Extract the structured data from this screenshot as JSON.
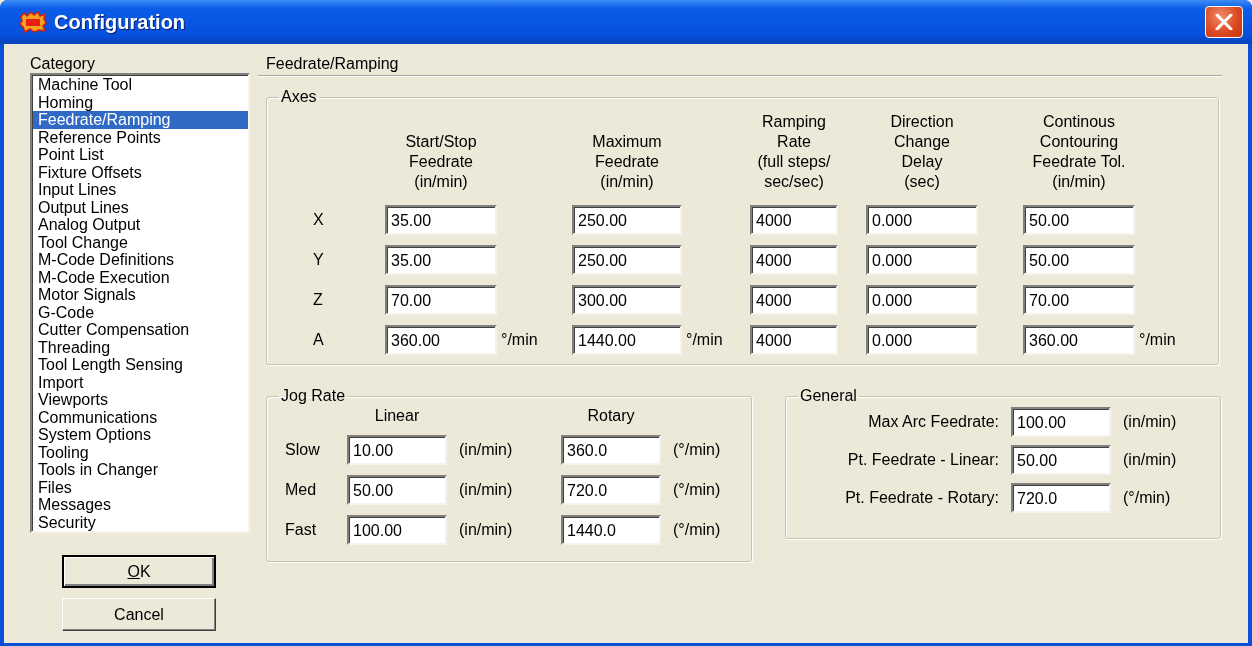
{
  "window": {
    "title": "Configuration"
  },
  "category": {
    "label": "Category",
    "items": [
      {
        "label": "Machine Tool",
        "selected": false
      },
      {
        "label": "Homing",
        "selected": false
      },
      {
        "label": "Feedrate/Ramping",
        "selected": true
      },
      {
        "label": "Reference Points",
        "selected": false
      },
      {
        "label": "Point List",
        "selected": false
      },
      {
        "label": "Fixture Offsets",
        "selected": false
      },
      {
        "label": "Input Lines",
        "selected": false
      },
      {
        "label": "Output Lines",
        "selected": false
      },
      {
        "label": "Analog Output",
        "selected": false
      },
      {
        "label": "Tool Change",
        "selected": false
      },
      {
        "label": "M-Code Definitions",
        "selected": false
      },
      {
        "label": "M-Code Execution",
        "selected": false
      },
      {
        "label": "Motor Signals",
        "selected": false
      },
      {
        "label": "G-Code",
        "selected": false
      },
      {
        "label": "Cutter Compensation",
        "selected": false
      },
      {
        "label": "Threading",
        "selected": false
      },
      {
        "label": "Tool Length Sensing",
        "selected": false
      },
      {
        "label": "Import",
        "selected": false
      },
      {
        "label": "Viewports",
        "selected": false
      },
      {
        "label": "Communications",
        "selected": false
      },
      {
        "label": "System Options",
        "selected": false
      },
      {
        "label": "Tooling",
        "selected": false
      },
      {
        "label": "Tools in Changer",
        "selected": false
      },
      {
        "label": "Files",
        "selected": false
      },
      {
        "label": "Messages",
        "selected": false
      },
      {
        "label": "Security",
        "selected": false
      }
    ]
  },
  "buttons": [
    {
      "label": "OK",
      "default": true
    },
    {
      "label": "Cancel",
      "default": false
    }
  ],
  "panel": {
    "title": "Feedrate/Ramping"
  },
  "axes": {
    "title": "Axes",
    "columns": [
      "Start/Stop\nFeedrate\n(in/min)",
      "Maximum\nFeedrate\n(in/min)",
      "Ramping\nRate\n(full steps/\nsec/sec)",
      "Direction\nChange\nDelay\n(sec)",
      "Continous\nContouring\nFeedrate Tol.\n(in/min)"
    ],
    "rows": [
      {
        "axis": "X",
        "cells": [
          {
            "value": "35.00"
          },
          {
            "value": "250.00"
          },
          {
            "value": "4000"
          },
          {
            "value": "0.000"
          },
          {
            "value": "50.00"
          }
        ]
      },
      {
        "axis": "Y",
        "cells": [
          {
            "value": "35.00"
          },
          {
            "value": "250.00"
          },
          {
            "value": "4000"
          },
          {
            "value": "0.000"
          },
          {
            "value": "50.00"
          }
        ]
      },
      {
        "axis": "Z",
        "cells": [
          {
            "value": "70.00"
          },
          {
            "value": "300.00"
          },
          {
            "value": "4000"
          },
          {
            "value": "0.000"
          },
          {
            "value": "70.00"
          }
        ]
      },
      {
        "axis": "A",
        "cells": [
          {
            "value": "360.00",
            "unit": "°/min"
          },
          {
            "value": "1440.00",
            "unit": "°/min"
          },
          {
            "value": "4000"
          },
          {
            "value": "0.000"
          },
          {
            "value": "360.00",
            "unit": "°/min"
          }
        ]
      }
    ]
  },
  "jog_rate": {
    "title": "Jog Rate",
    "columns": [
      "Linear",
      "Rotary"
    ],
    "rows": [
      {
        "label": "Slow",
        "linear": "10.00",
        "linear_unit": "(in/min)",
        "rotary": "360.0",
        "rotary_unit": "(°/min)"
      },
      {
        "label": "Med",
        "linear": "50.00",
        "linear_unit": "(in/min)",
        "rotary": "720.0",
        "rotary_unit": "(°/min)"
      },
      {
        "label": "Fast",
        "linear": "100.00",
        "linear_unit": "(in/min)",
        "rotary": "1440.0",
        "rotary_unit": "(°/min)"
      }
    ]
  },
  "general": {
    "title": "General",
    "rows": [
      {
        "label": "Max Arc Feedrate:",
        "value": "100.00",
        "unit": "(in/min)"
      },
      {
        "label": "Pt. Feedrate - Linear:",
        "value": "50.00",
        "unit": "(in/min)"
      },
      {
        "label": "Pt. Feedrate - Rotary:",
        "value": "720.0",
        "unit": "(°/min)"
      }
    ]
  }
}
